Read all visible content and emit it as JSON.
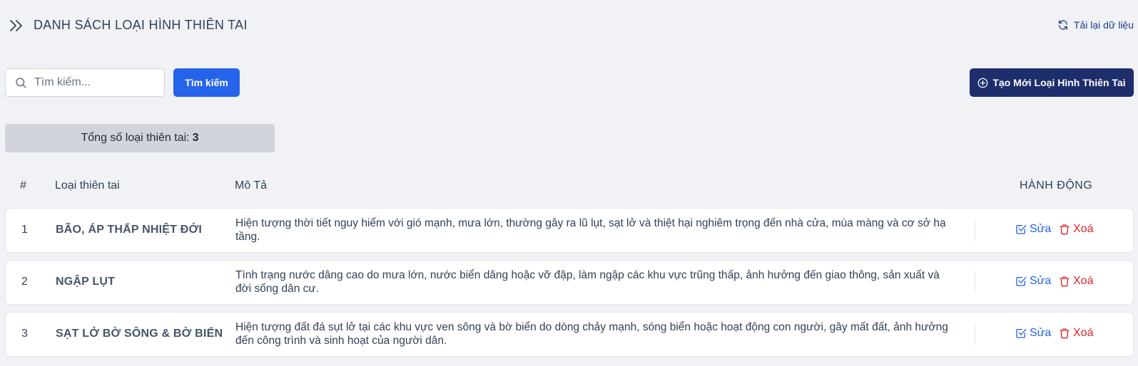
{
  "header": {
    "title": "DANH SÁCH LOẠI HÌNH THIÊN TAI",
    "reload_label": "Tải lại dữ liệu"
  },
  "search": {
    "placeholder": "Tìm kiếm...",
    "button_label": "Tìm kiếm"
  },
  "create_button_label": "Tạo Mới Loại Hình Thiên Tai",
  "summary": {
    "label": "Tổng số loại thiên tai:",
    "count": "3"
  },
  "table": {
    "headers": {
      "num": "#",
      "type": "Loại thiên tai",
      "description": "Mô Tả",
      "action": "HÀNH ĐỘNG"
    },
    "rows": [
      {
        "num": "1",
        "type": "BÃO, ÁP THẤP NHIỆT ĐỚI",
        "description": "Hiện tượng thời tiết nguy hiểm với gió mạnh, mưa lớn, thường gây ra lũ lụt, sạt lở và thiệt hại nghiêm trọng đến nhà cửa, mùa màng và cơ sở hạ tầng.",
        "edit_label": "Sửa",
        "delete_label": "Xoá"
      },
      {
        "num": "2",
        "type": "NGẬP LỤT",
        "description": "Tình trạng nước dâng cao do mưa lớn, nước biển dâng hoặc vỡ đập, làm ngập các khu vực trũng thấp, ảnh hưởng đến giao thông, sản xuất và đời sống dân cư.",
        "edit_label": "Sửa",
        "delete_label": "Xoá"
      },
      {
        "num": "3",
        "type": "SẠT LỞ BỜ SÔNG & BỜ BIỂN",
        "description": "Hiện tượng đất đá sụt lở tại các khu vực ven sông và bờ biển do dòng chảy mạnh, sóng biển hoặc hoạt động con người, gây mất đất, ảnh hưởng đến công trình và sinh hoạt của người dân.",
        "edit_label": "Sửa",
        "delete_label": "Xoá"
      }
    ]
  },
  "colors": {
    "primary": "#2563eb",
    "create_button": "#1e2d6b",
    "danger": "#dc2626",
    "background": "#f1f2f5"
  },
  "icons": {
    "expand": "double-chevron-right-icon",
    "reload": "refresh-icon",
    "search": "search-icon",
    "create": "plus-circle-icon",
    "edit": "edit-check-icon",
    "delete": "trash-icon"
  }
}
